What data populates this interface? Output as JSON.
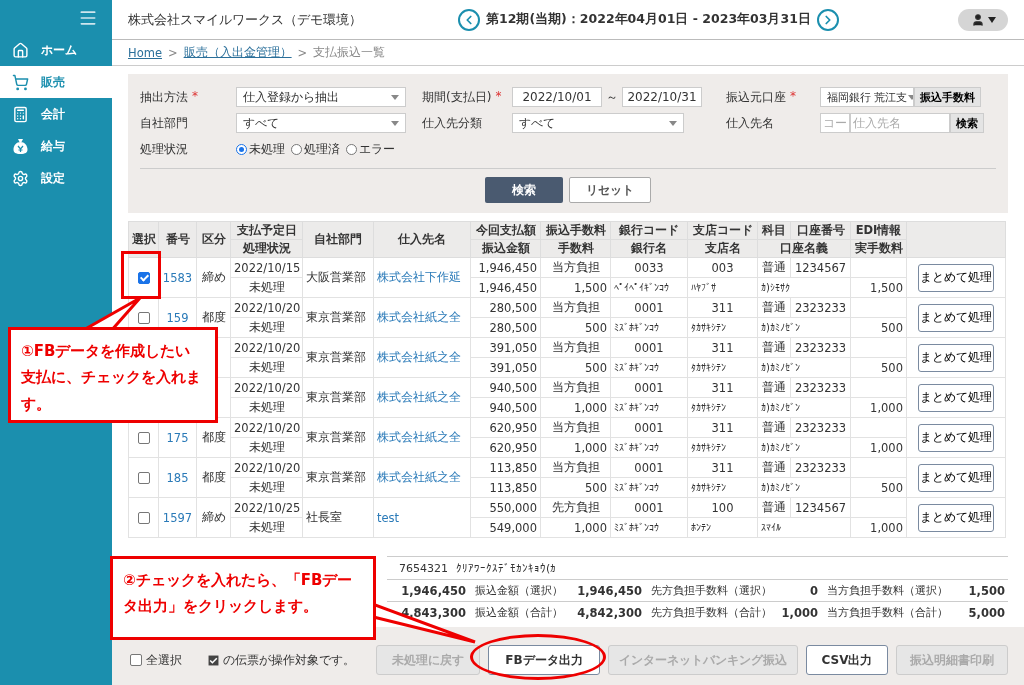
{
  "sidebar": {
    "items": [
      {
        "label": "ホーム",
        "selected": false
      },
      {
        "label": "販売",
        "selected": true
      },
      {
        "label": "会計",
        "selected": false
      },
      {
        "label": "給与",
        "selected": false
      },
      {
        "label": "設定",
        "selected": false
      }
    ]
  },
  "header": {
    "company": "株式会社スマイルワークス（デモ環境）",
    "period": "第12期(当期)：2022年04月01日 - 2023年03月31日"
  },
  "breadcrumb": [
    {
      "label": "Home",
      "link": true
    },
    {
      "before": ">",
      "label": "販売（入出金管理）",
      "link": true
    },
    {
      "before": ">",
      "label": "支払振込一覧",
      "link": false
    }
  ],
  "filters": {
    "method_label": "抽出方法",
    "method_mark": "*",
    "method": "仕入登録から抽出",
    "period_label": "期間(支払日)",
    "period_mark": "*",
    "date_from": "2022/10/01",
    "tilde": "～",
    "date_to": "2022/10/31",
    "account_label": "振込元口座",
    "account_mark": "*",
    "account": "福岡銀行 荒江支",
    "fee_button": "振込手数料",
    "dept_label": "自社部門",
    "dept": "すべて",
    "vendor_class_label": "仕入先分類",
    "vendor_class": "すべて",
    "vendor_label": "仕入先名",
    "vendor_code_placeholder": "コー",
    "vendor_name_placeholder": "仕入先名",
    "vendor_search": "検索",
    "status_label": "処理状況",
    "statuses": [
      {
        "label": "未処理",
        "selected": true
      },
      {
        "label": "処理済",
        "selected": false
      },
      {
        "label": "エラー",
        "selected": false
      }
    ],
    "search_button": "検索",
    "reset_button": "リセット"
  },
  "table": {
    "columns": [
      [
        "選択"
      ],
      [
        "番号"
      ],
      [
        "区分"
      ],
      [
        "支払予定日",
        "処理状況"
      ],
      [
        "自社部門"
      ],
      [
        "仕入先名"
      ],
      [
        "今回支払額",
        "振込金額"
      ],
      [
        "振込手数料",
        "手数料"
      ],
      [
        "銀行コード",
        "銀行名"
      ],
      [
        "支店コード",
        "支店名"
      ],
      [
        "科目",
        "口座番号",
        "口座名義"
      ],
      [
        "EDI情報",
        "実手数料"
      ]
    ],
    "rows": [
      {
        "checked": true,
        "number": "1583",
        "kind": "締め",
        "date": "2022/10/15",
        "status": "未処理",
        "dept": "大阪営業部",
        "vendor": "株式会社下作延",
        "amount": "1,946,450",
        "transfer": "1,946,450",
        "fee_type": "当方負担",
        "fee": "1,500",
        "bank_code": "0033",
        "bank": "ﾍﾟｲﾍﾟｲｷﾞﾝｺｳ",
        "branch_code": "003",
        "branch": "ﾊﾔﾌﾞｻ",
        "subject": "普通",
        "account_no": "1234567",
        "holder": "ｶ)ｼﾓｻｸ",
        "actual_fee": "1,500",
        "action": "まとめて処理"
      },
      {
        "checked": false,
        "number": "159",
        "kind": "都度",
        "date": "2022/10/20",
        "status": "未処理",
        "dept": "東京営業部",
        "vendor": "株式会社紙之全",
        "amount": "280,500",
        "transfer": "280,500",
        "fee_type": "当方負担",
        "fee": "500",
        "bank_code": "0001",
        "bank": "ﾐｽﾞﾎｷﾞﾝｺｳ",
        "branch_code": "311",
        "branch": "ﾀｶｻｷｼﾃﾝ",
        "subject": "普通",
        "account_no": "2323233",
        "holder": "ｶ)ｶﾐﾉｾﾞﾝ",
        "actual_fee": "500",
        "action": "まとめて処理"
      },
      {
        "date": "2022/10/20",
        "status": "未処理",
        "dept": "東京営業部",
        "vendor": "株式会社紙之全",
        "amount": "391,050",
        "transfer": "391,050",
        "fee_type": "当方負担",
        "fee": "500",
        "bank_code": "0001",
        "bank": "ﾐｽﾞﾎｷﾞﾝｺｳ",
        "branch_code": "311",
        "branch": "ﾀｶｻｷｼﾃﾝ",
        "subject": "普通",
        "account_no": "2323233",
        "holder": "ｶ)ｶﾐﾉｾﾞﾝ",
        "actual_fee": "500",
        "action": "まとめて処理"
      },
      {
        "date": "2022/10/20",
        "status": "未処理",
        "dept": "東京営業部",
        "vendor": "株式会社紙之全",
        "amount": "940,500",
        "transfer": "940,500",
        "fee_type": "当方負担",
        "fee": "1,000",
        "bank_code": "0001",
        "bank": "ﾐｽﾞﾎｷﾞﾝｺｳ",
        "branch_code": "311",
        "branch": "ﾀｶｻｷｼﾃﾝ",
        "subject": "普通",
        "account_no": "2323233",
        "holder": "ｶ)ｶﾐﾉｾﾞﾝ",
        "actual_fee": "1,000",
        "action": "まとめて処理"
      },
      {
        "checked": false,
        "number": "175",
        "kind": "都度",
        "date": "2022/10/20",
        "status": "未処理",
        "dept": "東京営業部",
        "vendor": "株式会社紙之全",
        "amount": "620,950",
        "transfer": "620,950",
        "fee_type": "当方負担",
        "fee": "1,000",
        "bank_code": "0001",
        "bank": "ﾐｽﾞﾎｷﾞﾝｺｳ",
        "branch_code": "311",
        "branch": "ﾀｶｻｷｼﾃﾝ",
        "subject": "普通",
        "account_no": "2323233",
        "holder": "ｶ)ｶﾐﾉｾﾞﾝ",
        "actual_fee": "1,000",
        "action": "まとめて処理"
      },
      {
        "checked": false,
        "number": "185",
        "kind": "都度",
        "date": "2022/10/20",
        "status": "未処理",
        "dept": "東京営業部",
        "vendor": "株式会社紙之全",
        "amount": "113,850",
        "transfer": "113,850",
        "fee_type": "当方負担",
        "fee": "500",
        "bank_code": "0001",
        "bank": "ﾐｽﾞﾎｷﾞﾝｺｳ",
        "branch_code": "311",
        "branch": "ﾀｶｻｷｼﾃﾝ",
        "subject": "普通",
        "account_no": "2323233",
        "holder": "ｶ)ｶﾐﾉｾﾞﾝ",
        "actual_fee": "500",
        "action": "まとめて処理"
      },
      {
        "checked": false,
        "number": "1597",
        "kind": "締め",
        "date": "2022/10/25",
        "status": "未処理",
        "dept": "社長室",
        "vendor": "test",
        "amount": "550,000",
        "transfer": "549,000",
        "fee_type": "先方負担",
        "fee": "1,000",
        "bank_code": "0001",
        "bank": "ﾐｽﾞﾎｷﾞﾝｺｳ",
        "branch_code": "100",
        "branch": "ﾎﾝﾃﾝ",
        "subject": "普通",
        "account_no": "1234567",
        "holder": "ｽﾏｲﾙ",
        "actual_fee": "1,000",
        "action": "まとめて処理"
      }
    ]
  },
  "summary": {
    "account_no": "7654321",
    "account_name": "ｸﾘｱﾜｰｸｽﾃﾞﾓｶﾝｷｮｳ(ｶ",
    "rows": [
      [
        {
          "value": "1,946,450"
        },
        {
          "label": "振込金額（選択）",
          "value": "1,946,450"
        },
        {
          "label": "先方負担手数料（選択）",
          "value": "0"
        },
        {
          "label": "当方負担手数料（選択）",
          "value": "1,500"
        }
      ],
      [
        {
          "value": "4,843,300"
        },
        {
          "label": "振込金額（合計）",
          "value": "4,842,300"
        },
        {
          "label": "先方負担手数料（合計）",
          "value": "1,000"
        },
        {
          "label": "当方負担手数料（合計）",
          "value": "5,000"
        }
      ]
    ]
  },
  "footer": {
    "select_all": {
      "label": "全選択",
      "checked": false
    },
    "note": "の伝票が操作対象です。",
    "buttons": [
      {
        "label": "未処理に戻す",
        "disabled": true
      },
      {
        "label": "FBデータ出力",
        "disabled": false
      },
      {
        "label": "インターネットバンキング振込",
        "disabled": true
      },
      {
        "label": "CSV出力",
        "disabled": false
      },
      {
        "label": "振込明細書印刷",
        "disabled": true
      }
    ]
  },
  "annotations": [
    {
      "text": "①FBデータを作成したい支払に、チェックを入れます。"
    },
    {
      "text": "②チェックを入れたら、「FBデータ出力」をクリックします。"
    }
  ]
}
